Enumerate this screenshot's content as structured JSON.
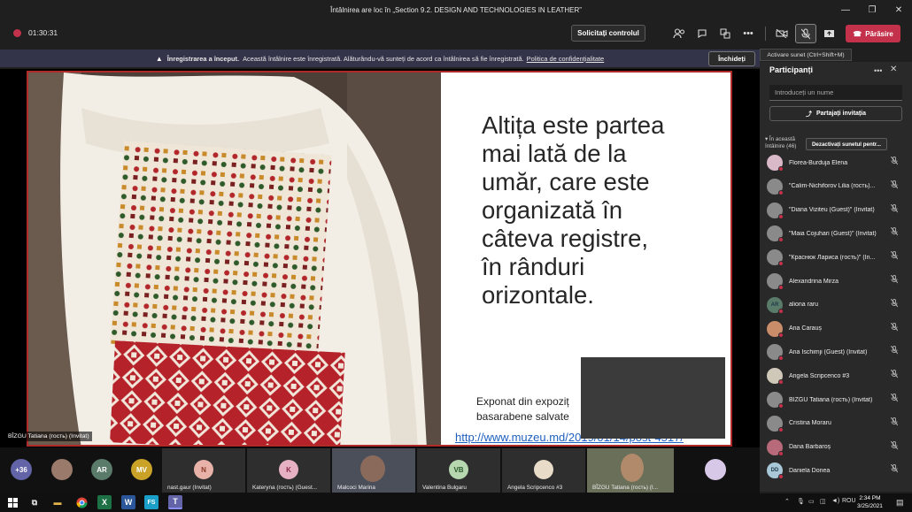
{
  "window": {
    "title": "Întâlnirea are loc în „Section 9.2. DESIGN AND TECHNOLOGIES IN LEATHER”",
    "controls": [
      "—",
      "❐",
      "✕"
    ]
  },
  "toolbar": {
    "timer": "01:30:31",
    "request_control": "Solicitați controlul",
    "leave": "Părăsire",
    "tooltip": "Activare sunet (Ctrl+Shift+M)"
  },
  "banner": {
    "bold": "Înregistrarea a început.",
    "text": "Această întâlnire este înregistrată. Alăturându-vă sunteți de acord ca întâlnirea să fie înregistrată.",
    "link": "Politica de confidențialitate",
    "close": "Închideți"
  },
  "slide": {
    "text": "Altița este partea\nmai lată de la\număr, care este\norganizată în\ncâteva registre,\nîn rânduri\norizontale.",
    "caption": "Exponat din expoziț\nbasarabene salvate",
    "link": "http://www.muzeu.md/2019/01/14/post-4517/"
  },
  "presenter_label": "BÎZGU Tatiana (гость) (Invitat)",
  "gallery": {
    "overflow": "+36",
    "tiles": [
      {
        "initials": "AR",
        "color": "#5a7a6a"
      },
      {
        "initials": "MV",
        "color": "#c9a227"
      },
      {
        "initials": "N",
        "color": "#e8b2a9",
        "name": "nast.gaur (Invitat)"
      },
      {
        "initials": "K",
        "color": "#e6b1c3",
        "name": "Kateryna (гость) (Guest..."
      },
      {
        "initials": "",
        "color": "#556",
        "name": "Malcoci Marina"
      },
      {
        "initials": "VB",
        "color": "#b6d7b0",
        "name": "Valentina Bulgaru"
      },
      {
        "initials": "",
        "color": "#ccc",
        "name": "Angela Scripcenco #3"
      },
      {
        "initials": "",
        "color": "#556",
        "name": "BÎZGU Tatiana (гость) (I..."
      }
    ]
  },
  "participants": {
    "title": "Participanți",
    "search_placeholder": "Introduceți un nume",
    "share": "Partajați invitația",
    "section": "În această\nîntâlnire (46)",
    "mute_all": "Dezactivați sunetul pentr...",
    "people": [
      {
        "name": "Florea-Burduja Elena",
        "initials": "",
        "color": "#d9b8c8"
      },
      {
        "name": "\"Calim-Nichiforov Lilia (гость)...",
        "initials": "",
        "color": "#8a8a8a"
      },
      {
        "name": "\"Diana Viziteu (Guest)\" (Invitat)",
        "initials": "",
        "color": "#8a8a8a"
      },
      {
        "name": "\"Maia Cojuhari (Guest)\" (Invitat)",
        "initials": "",
        "color": "#8a8a8a"
      },
      {
        "name": "\"Краснюк Лариса (гость)\" (In...",
        "initials": "",
        "color": "#8a8a8a"
      },
      {
        "name": "Alexandrina Mirza",
        "initials": "",
        "color": "#8a8a8a"
      },
      {
        "name": "aliona raru",
        "initials": "AR",
        "color": "#5a7a6a"
      },
      {
        "name": "Ana Carauș",
        "initials": "",
        "color": "#c98d6a"
      },
      {
        "name": "Ana Ischimji (Guest) (Invitat)",
        "initials": "",
        "color": "#8a8a8a"
      },
      {
        "name": "Angela Scripcenco #3",
        "initials": "",
        "color": "#cfc7b8"
      },
      {
        "name": "BÎZGU Tatiana (гость) (Invitat)",
        "initials": "",
        "color": "#8a8a8a"
      },
      {
        "name": "Cristina Moraru",
        "initials": "",
        "color": "#8a8a8a"
      },
      {
        "name": "Dana Barbaroș",
        "initials": "",
        "color": "#b86a7a"
      },
      {
        "name": "Daniela Donea",
        "initials": "DD",
        "color": "#a8c8d8"
      }
    ]
  },
  "taskbar": {
    "lang": "ROU",
    "time": "2:34 PM",
    "date": "3/25/2021"
  }
}
